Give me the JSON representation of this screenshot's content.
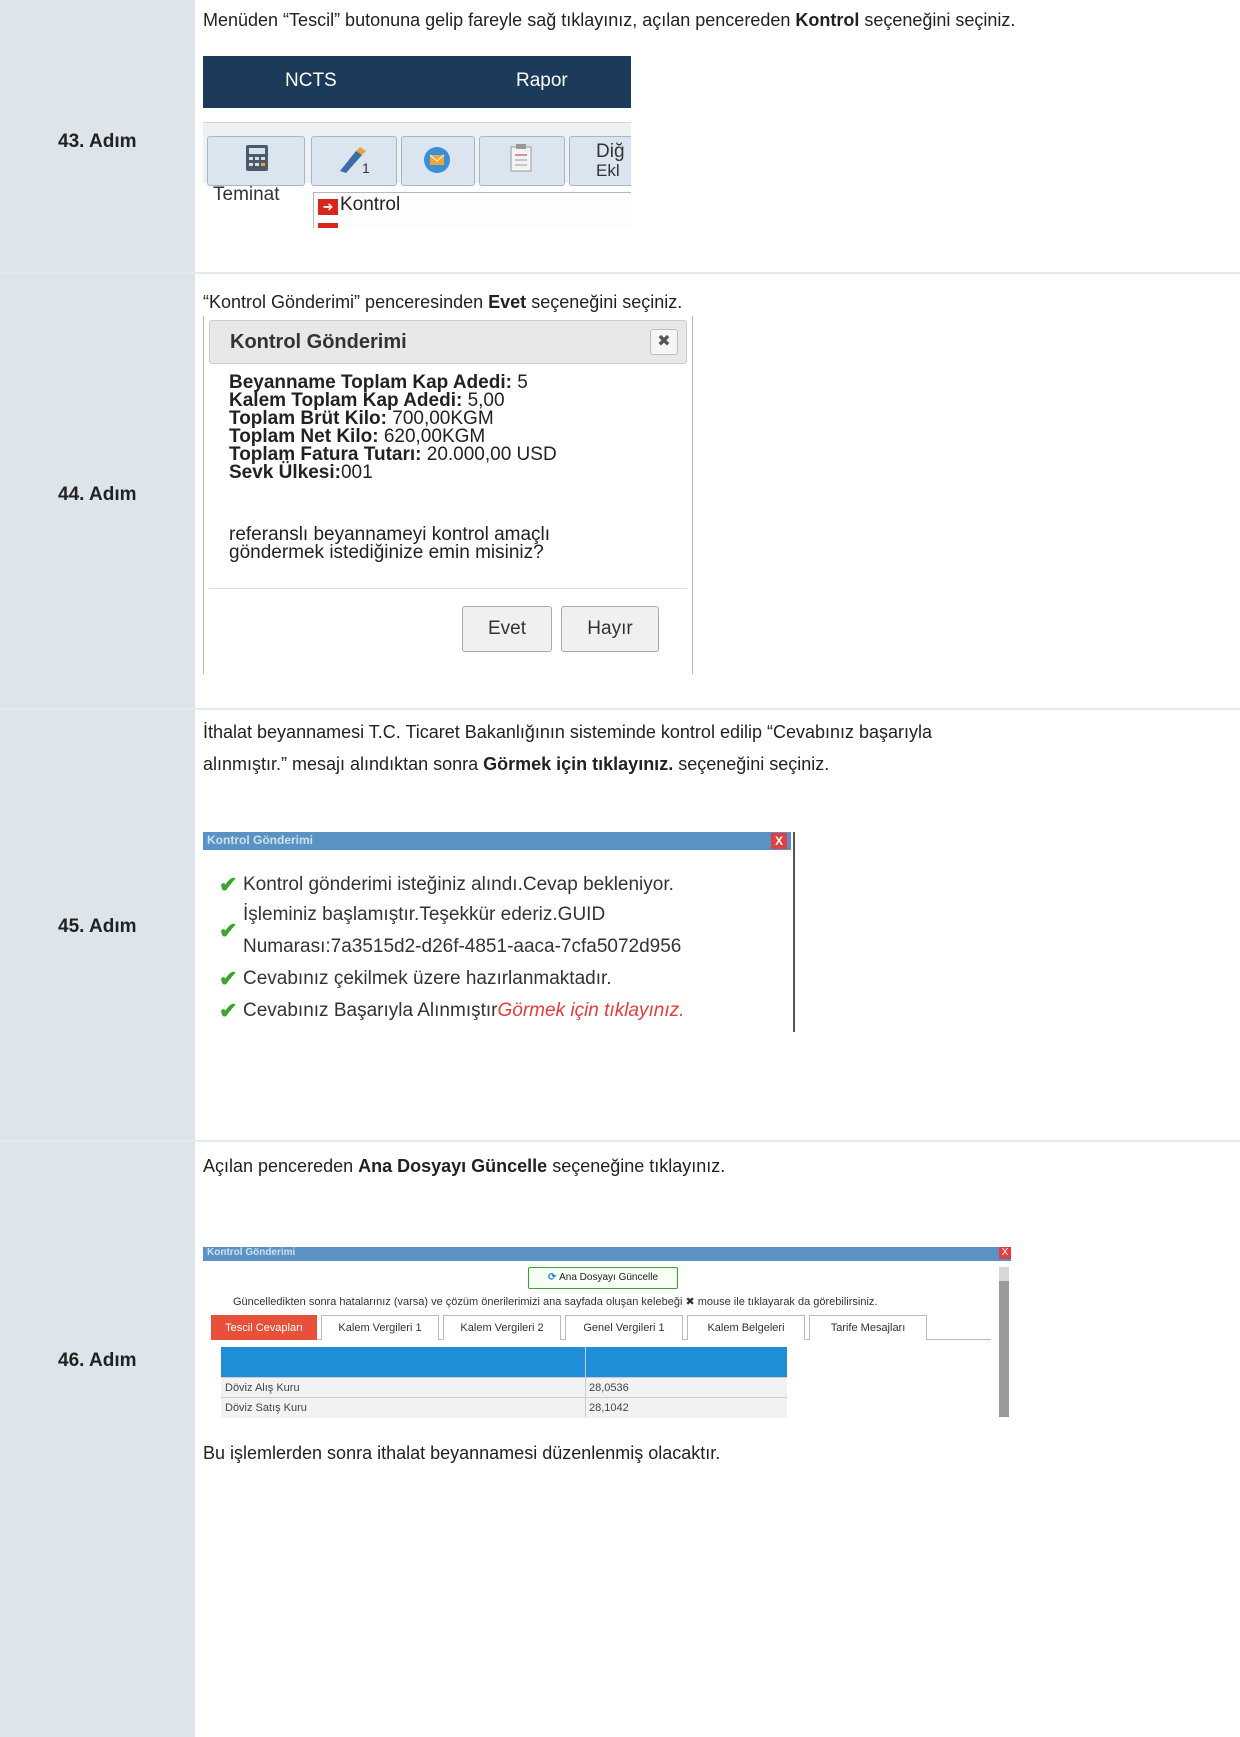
{
  "steps": [
    {
      "label": "43. Adım",
      "desc_pre": "Menüden “Tescil” butonuna gelip fareyle sağ tıklayınız, açılan pencereden ",
      "desc_bold": "Kontrol",
      "desc_post": " seçeneğini seçiniz.",
      "ui": {
        "nav_items": [
          "NCTS",
          "Rapor"
        ],
        "toolbar_label_1": "Teminat",
        "toolbar_label_partial": "Diğ",
        "toolbar_label_partial2": "Ekl",
        "menu_item": "Kontrol"
      }
    },
    {
      "label": "44. Adım",
      "desc_pre": "“Kontrol Gönderimi” penceresinden ",
      "desc_bold": "Evet",
      "desc_post": " seçeneğini seçiniz.",
      "dialog": {
        "title": "Kontrol Gönderimi",
        "close": "✖",
        "fields": [
          {
            "k": "Beyanname Toplam Kap Adedi:",
            "v": " 5"
          },
          {
            "k": "Kalem Toplam Kap Adedi:",
            "v": " 5,00"
          },
          {
            "k": "Toplam Brüt Kilo:",
            "v": " 700,00KGM"
          },
          {
            "k": "Toplam Net Kilo:",
            "v": " 620,00KGM"
          },
          {
            "k": "Toplam Fatura Tutarı:",
            "v": " 20.000,00 USD"
          },
          {
            "k": "Sevk Ülkesi:",
            "v": "001"
          }
        ],
        "question_1": "referanslı beyannameyi kontrol amaçlı",
        "question_2": "göndermek istediğinize emin misiniz?",
        "yes_label": "Evet",
        "no_label": "Hayır"
      }
    },
    {
      "label": "45. Adım",
      "desc_line1": "İthalat beyannamesi T.C. Ticaret Bakanlığının sisteminde kontrol edilip “Cevabınız başarıyla",
      "desc_line2_pre": "alınmıştır.” mesajı alındıktan sonra ",
      "desc_bold": "Görmek için tıklayınız.",
      "desc_post": " seçeneğini seçiniz.",
      "window": {
        "title": "Kontrol Gönderimi",
        "close": "X",
        "lines": [
          "Kontrol gönderimi isteğiniz alındı.Cevap bekleniyor.",
          "İşleminiz başlamıştır.Teşekkür ederiz.GUID",
          "Numarası:7a3515d2-d26f-4851-aaca-7cfa5072d956",
          "Cevabınız çekilmek üzere hazırlanmaktadır.",
          "Cevabınız Başarıyla Alınmıştır"
        ],
        "link": "Görmek için tıklayınız."
      }
    },
    {
      "label": "46. Adım",
      "desc_pre": "Açılan pencereden ",
      "desc_bold": "Ana Dosyayı Güncelle",
      "desc_post": " seçeneğine tıklayınız.",
      "window": {
        "title": "Kontrol Gönderimi",
        "close": "X",
        "update_button": "Ana Dosyayı Güncelle",
        "note": "Güncelledikten sonra hatalarınız (varsa) ve çözüm önerilerimizi ana sayfada oluşan kelebeği  ✖  mouse ile tıklayarak da görebilirsiniz.",
        "tabs": [
          "Tescil Cevapları",
          "Kalem Vergileri 1",
          "Kalem Vergileri 2",
          "Genel Vergileri 1",
          "Kalem Belgeleri",
          "Tarife Mesajları"
        ],
        "rows": [
          {
            "name": "Döviz Alış Kuru",
            "value": "28,0536"
          },
          {
            "name": "Döviz Satış Kuru",
            "value": "28,1042"
          }
        ]
      },
      "footer": "Bu işlemlerden sonra ithalat beyannamesi düzenlenmiş olacaktır."
    }
  ]
}
